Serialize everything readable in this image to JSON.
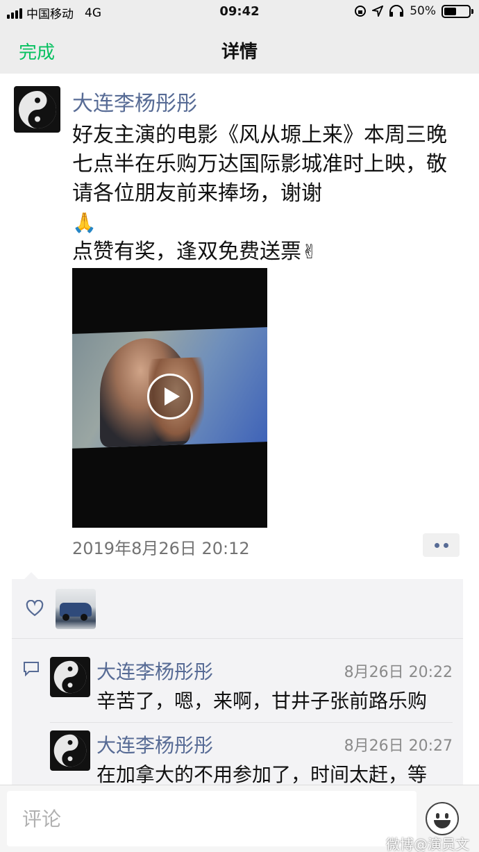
{
  "status_bar": {
    "carrier": "中国移动",
    "network": "4G",
    "time": "09:42",
    "battery": "50%",
    "battery_level": 0.5
  },
  "navbar": {
    "done_label": "完成",
    "title": "详情"
  },
  "post": {
    "author": "大连李杨彤彤",
    "text_line1": "好友主演的电影《风从塬上来》本周三晚七点半在乐购万达国际影城准时上映，敬请各位朋友前来捧场，谢谢",
    "emoji_pray": "🙏",
    "text_line2": "点赞有奖，逢双免费送票",
    "emoji_victory": "✌",
    "timestamp": "2019年8月26日 20:12"
  },
  "comments": [
    {
      "author": "大连李杨彤彤",
      "time": "8月26日 20:22",
      "text": "辛苦了，嗯，来啊，甘井子张前路乐购"
    },
    {
      "author": "大连李杨彤彤",
      "time": "8月26日 20:27",
      "text": "在加拿大的不用参加了，时间太赶，等"
    }
  ],
  "bottom_bar": {
    "comment_placeholder": "评论"
  },
  "watermark": "微博@演员文江-",
  "colors": {
    "accent_green": "#07c160",
    "link_blue": "#576b95",
    "nav_bg": "#ededed"
  },
  "icons": [
    "signal-icon",
    "location-icon",
    "headphones-icon",
    "battery-icon",
    "play-icon",
    "heart-icon",
    "comment-icon",
    "emoji-icon",
    "more-icon"
  ]
}
